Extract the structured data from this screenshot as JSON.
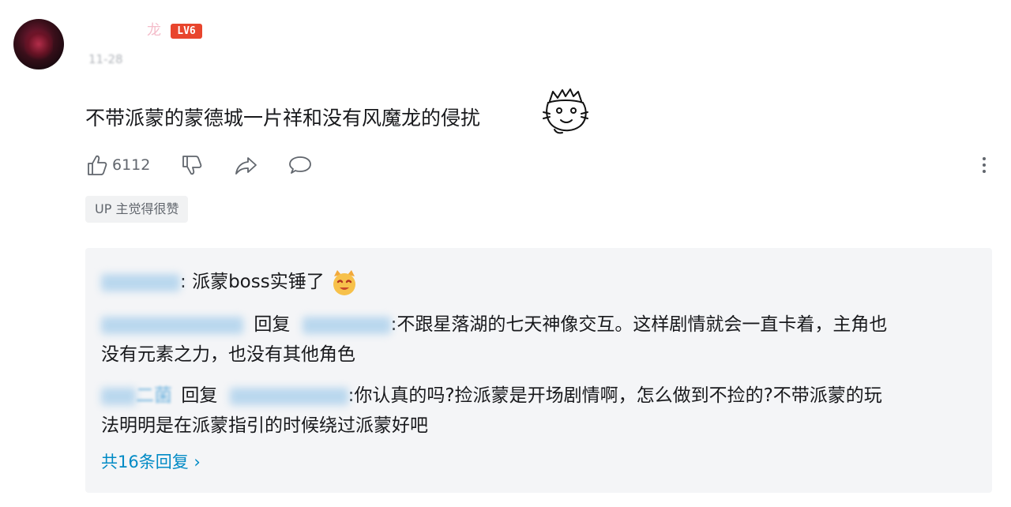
{
  "comment": {
    "username_visible_tail": "龙",
    "level": "LV6",
    "time": "11-28",
    "text": "不带派蒙的蒙德城一片祥和没有风魔龙的侵扰",
    "sticker": "cat-sticker-icon",
    "like_count": "6112",
    "up_badge": "UP 主觉得很赞"
  },
  "replies": [
    {
      "separator": ":",
      "text": "派蒙boss实锤了",
      "emoji": "cat-smile-emoji"
    },
    {
      "verb": "回复",
      "text": ":不跟星落湖的七天神像交互。这样剧情就会一直卡着，主角也",
      "text2": "没有元素之力，也没有其他角色"
    },
    {
      "visible_name_fragment": "二菌",
      "verb": "回复",
      "text": ":你认真的吗?捡派蒙是开场剧情啊，怎么做到不捡的?不带派蒙的玩",
      "text2": "法明明是在派蒙指引的时候绕过派蒙好吧"
    }
  ],
  "more_replies": "共16条回复 ›",
  "colors": {
    "level_badge": "#e8452d",
    "link": "#008ac5",
    "reply_bg": "#f4f5f7"
  }
}
